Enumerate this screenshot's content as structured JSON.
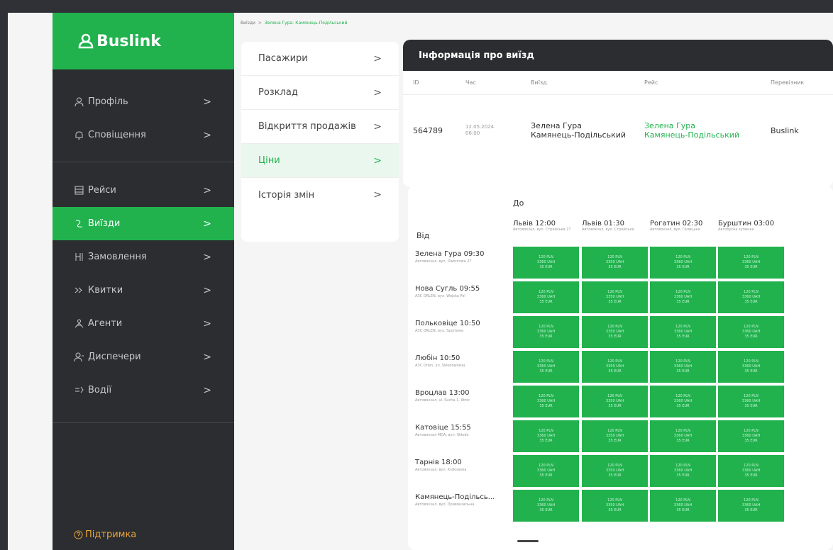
{
  "brand": {
    "name": "Buslink",
    "accent": "#21b24e",
    "sidebar_bg": "#2b2d30"
  },
  "sidebar": {
    "group1": [
      {
        "label": "Профіль",
        "icon": "user-icon"
      },
      {
        "label": "Сповіщення",
        "icon": "bell-icon"
      }
    ],
    "group2": [
      {
        "label": "Рейси",
        "icon": "list-icon"
      },
      {
        "label": "Виїзди",
        "icon": "route-icon",
        "active": true
      },
      {
        "label": "Замовлення",
        "icon": "orders-icon"
      },
      {
        "label": "Квитки",
        "icon": "ticket-icon"
      },
      {
        "label": "Агенти",
        "icon": "agents-icon"
      },
      {
        "label": "Диспечери",
        "icon": "dispatcher-icon"
      },
      {
        "label": "Водії",
        "icon": "driver-icon"
      }
    ],
    "support": "Підтримка"
  },
  "breadcrumb": {
    "root": "Виїзди",
    "sep": ">",
    "current": "Зелена Гура- Камянець-Подільський"
  },
  "submenu": [
    {
      "label": "Пасажири"
    },
    {
      "label": "Розклад"
    },
    {
      "label": "Відкриття продажів"
    },
    {
      "label": "Ціни",
      "active": true
    },
    {
      "label": "Історія змін"
    }
  ],
  "trip_info": {
    "title": "Інформація про виїзд",
    "columns": [
      "ID",
      "Час",
      "Виїзд",
      "Рейс",
      "Перевізник"
    ],
    "row": {
      "id": "564789",
      "time_date": "12.05.2024",
      "time_hour": "06:00",
      "trip_from": "Зелена Гура",
      "trip_to": "Камянець-Подільський",
      "route_from": "Зелена Гура",
      "route_to": "Камянець-Подільський",
      "carrier": "Buslink"
    }
  },
  "prices": {
    "to_label": "До",
    "from_label": "Від",
    "to_stops": [
      {
        "city": "Львів 12:00",
        "addr": "Автовокзал, вул. Стрийська 27"
      },
      {
        "city": "Львів 01:30",
        "addr": "Автовокзал, вул. Стрийська"
      },
      {
        "city": "Рогатин 02:30",
        "addr": "Автовокзал, вул. Галицька"
      },
      {
        "city": "Бурштин 03:00",
        "addr": "Автобусна зупинка"
      }
    ],
    "from_stops": [
      {
        "city": "Зелена Гура 09:30",
        "addr": "Автовокзал, вул. Dworcowa 27"
      },
      {
        "city": "Нова Сугль 09:55",
        "addr": "АЗС ORLEN, вул. Wojska Pol"
      },
      {
        "city": "Польковіце 10:50",
        "addr": "АЗС ORLEN, вул. Sportowa"
      },
      {
        "city": "Любін 10:50",
        "addr": "АЗС Orlen, ул. Skłodowskiej"
      },
      {
        "city": "Вроцлав 13:00",
        "addr": "Автовокзал, ul. Sucha 1, Wroc"
      },
      {
        "city": "Катовіце 15:55",
        "addr": "Автовокзал MDA, вул. Skłodo"
      },
      {
        "city": "Тарнів 18:00",
        "addr": "Автовокзал, вул. Krakowska"
      },
      {
        "city": "Камянець-Подільсь...",
        "addr": "Автовокзал, вул. Привокзальна"
      }
    ],
    "cell_values": [
      [
        "120 PLN",
        "3360 UAH",
        "35 EUR"
      ],
      [
        "120 PLN",
        "3350 UAH",
        "35 EUR"
      ],
      [
        "120 PLN",
        "3360 UAH",
        "35 EUR"
      ],
      [
        "120 PLN",
        "3360 UAH",
        "35 EUR"
      ]
    ]
  }
}
